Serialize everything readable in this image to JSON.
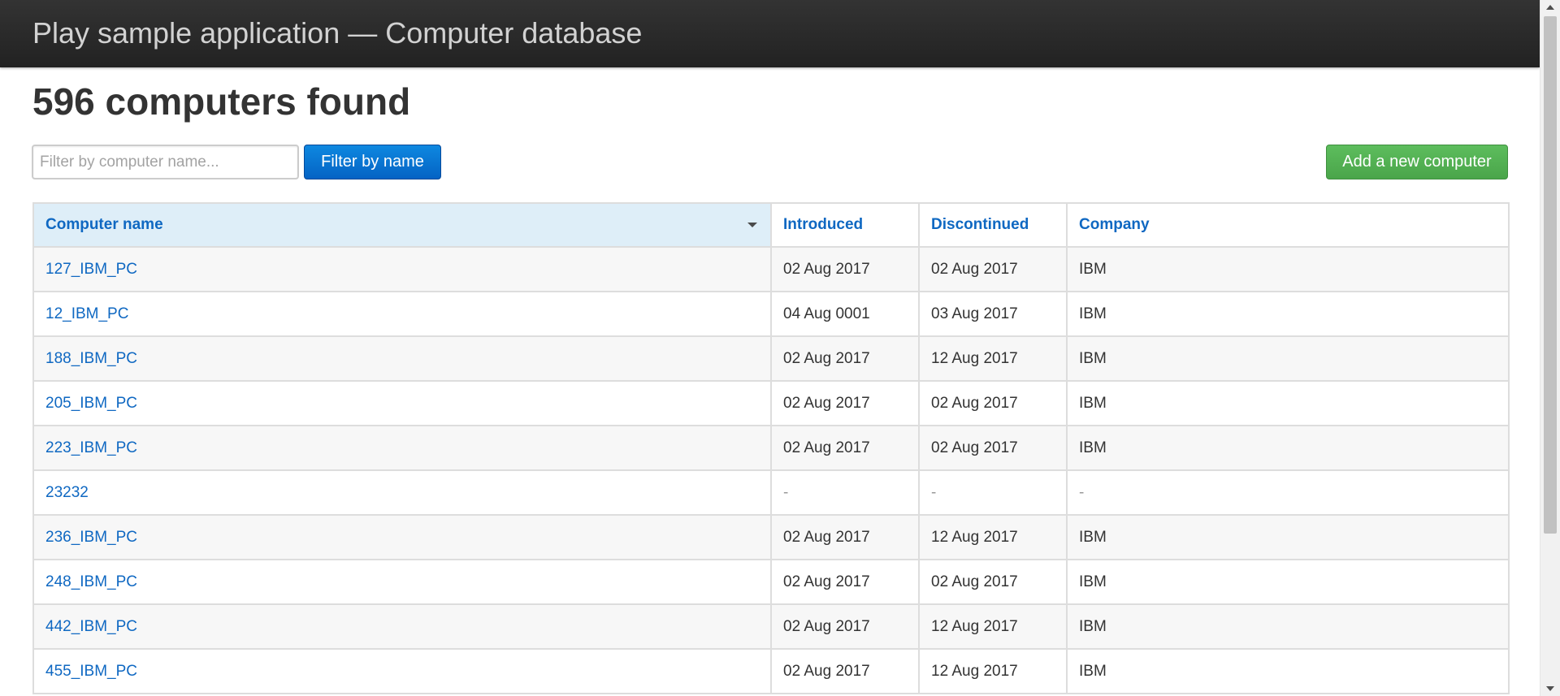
{
  "header": {
    "title": "Play sample application — Computer database"
  },
  "main": {
    "heading": "596 computers found",
    "search": {
      "placeholder": "Filter by computer name...",
      "value": ""
    },
    "filter_button_label": "Filter by name",
    "add_button_label": "Add a new computer"
  },
  "table": {
    "columns": [
      "Computer name",
      "Introduced",
      "Discontinued",
      "Company"
    ],
    "sorted_column": "Computer name",
    "rows": [
      [
        "127_IBM_PC",
        "02 Aug 2017",
        "02 Aug 2017",
        "IBM"
      ],
      [
        "12_IBM_PC",
        "04 Aug 0001",
        "03 Aug 2017",
        "IBM"
      ],
      [
        "188_IBM_PC",
        "02 Aug 2017",
        "12 Aug 2017",
        "IBM"
      ],
      [
        "205_IBM_PC",
        "02 Aug 2017",
        "02 Aug 2017",
        "IBM"
      ],
      [
        "223_IBM_PC",
        "02 Aug 2017",
        "02 Aug 2017",
        "IBM"
      ],
      [
        "23232",
        "-",
        "-",
        "-"
      ],
      [
        "236_IBM_PC",
        "02 Aug 2017",
        "12 Aug 2017",
        "IBM"
      ],
      [
        "248_IBM_PC",
        "02 Aug 2017",
        "02 Aug 2017",
        "IBM"
      ],
      [
        "442_IBM_PC",
        "02 Aug 2017",
        "12 Aug 2017",
        "IBM"
      ],
      [
        "455_IBM_PC",
        "02 Aug 2017",
        "12 Aug 2017",
        "IBM"
      ]
    ]
  },
  "colors": {
    "topbar": "#222222",
    "link": "#0f68c2",
    "primary_button": "#0463c4",
    "success_button": "#4aa54a",
    "sorted_header_bg": "#deeef8"
  },
  "icons": {
    "sort": "caret-down-icon"
  }
}
